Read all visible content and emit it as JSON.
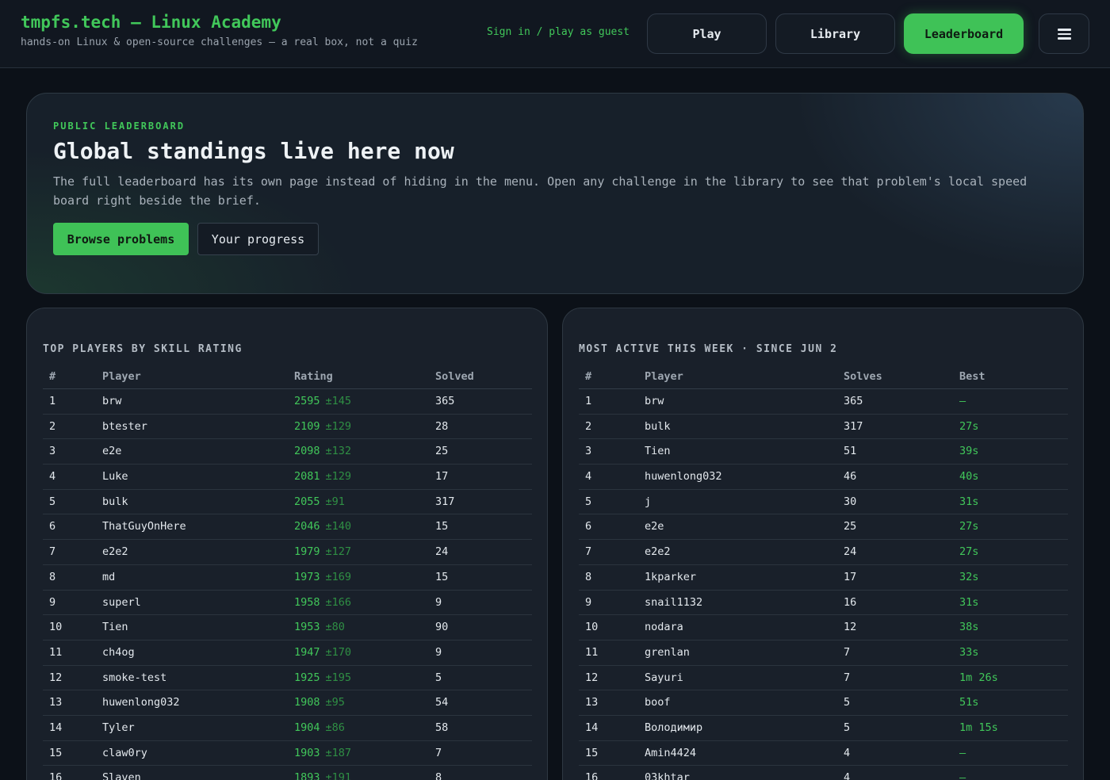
{
  "header": {
    "brand_title": "tmpfs.tech — Linux Academy",
    "brand_subtitle": "hands-on Linux & open-source challenges — a real box, not a quiz",
    "signin_label": "Sign in / play as guest",
    "nav": {
      "play": "Play",
      "library": "Library",
      "leaderboard": "Leaderboard"
    },
    "menu_icon": "hamburger-menu-icon",
    "accent_color": "#3fc257"
  },
  "hero": {
    "eyebrow": "PUBLIC LEADERBOARD",
    "title": "Global standings live here now",
    "description": "The full leaderboard has its own page instead of hiding in the menu. Open any challenge in the library to see that problem's local speed board right beside the brief.",
    "primary_button": "Browse problems",
    "secondary_button": "Your progress"
  },
  "top_players": {
    "title": "TOP PLAYERS BY SKILL RATING",
    "columns": [
      "#",
      "Player",
      "Rating",
      "Solved"
    ],
    "rows": [
      {
        "rank": "1",
        "player": "brw",
        "rating": "2595",
        "deviation": "±145",
        "solved": "365"
      },
      {
        "rank": "2",
        "player": "btester",
        "rating": "2109",
        "deviation": "±129",
        "solved": "28"
      },
      {
        "rank": "3",
        "player": "e2e",
        "rating": "2098",
        "deviation": "±132",
        "solved": "25"
      },
      {
        "rank": "4",
        "player": "Luke",
        "rating": "2081",
        "deviation": "±129",
        "solved": "17"
      },
      {
        "rank": "5",
        "player": "bulk",
        "rating": "2055",
        "deviation": "±91",
        "solved": "317"
      },
      {
        "rank": "6",
        "player": "ThatGuyOnHere",
        "rating": "2046",
        "deviation": "±140",
        "solved": "15"
      },
      {
        "rank": "7",
        "player": "e2e2",
        "rating": "1979",
        "deviation": "±127",
        "solved": "24"
      },
      {
        "rank": "8",
        "player": "md",
        "rating": "1973",
        "deviation": "±169",
        "solved": "15"
      },
      {
        "rank": "9",
        "player": "superl",
        "rating": "1958",
        "deviation": "±166",
        "solved": "9"
      },
      {
        "rank": "10",
        "player": "Tien",
        "rating": "1953",
        "deviation": "±80",
        "solved": "90"
      },
      {
        "rank": "11",
        "player": "ch4og",
        "rating": "1947",
        "deviation": "±170",
        "solved": "9"
      },
      {
        "rank": "12",
        "player": "smoke-test",
        "rating": "1925",
        "deviation": "±195",
        "solved": "5"
      },
      {
        "rank": "13",
        "player": "huwenlong032",
        "rating": "1908",
        "deviation": "±95",
        "solved": "54"
      },
      {
        "rank": "14",
        "player": "Tyler",
        "rating": "1904",
        "deviation": "±86",
        "solved": "58"
      },
      {
        "rank": "15",
        "player": "claw0ry",
        "rating": "1903",
        "deviation": "±187",
        "solved": "7"
      },
      {
        "rank": "16",
        "player": "Slaven",
        "rating": "1893",
        "deviation": "±191",
        "solved": "8"
      }
    ]
  },
  "most_active": {
    "title": "MOST ACTIVE THIS WEEK · SINCE JUN 2",
    "columns": [
      "#",
      "Player",
      "Solves",
      "Best"
    ],
    "rows": [
      {
        "rank": "1",
        "player": "brw",
        "solves": "365",
        "best": "—"
      },
      {
        "rank": "2",
        "player": "bulk",
        "solves": "317",
        "best": "27s"
      },
      {
        "rank": "3",
        "player": "Tien",
        "solves": "51",
        "best": "39s"
      },
      {
        "rank": "4",
        "player": "huwenlong032",
        "solves": "46",
        "best": "40s"
      },
      {
        "rank": "5",
        "player": "j",
        "solves": "30",
        "best": "31s"
      },
      {
        "rank": "6",
        "player": "e2e",
        "solves": "25",
        "best": "27s"
      },
      {
        "rank": "7",
        "player": "e2e2",
        "solves": "24",
        "best": "27s"
      },
      {
        "rank": "8",
        "player": "1kparker",
        "solves": "17",
        "best": "32s"
      },
      {
        "rank": "9",
        "player": "snail1132",
        "solves": "16",
        "best": "31s"
      },
      {
        "rank": "10",
        "player": "nodara",
        "solves": "12",
        "best": "38s"
      },
      {
        "rank": "11",
        "player": "grenlan",
        "solves": "7",
        "best": "33s"
      },
      {
        "rank": "12",
        "player": "Sayuri",
        "solves": "7",
        "best": "1m 26s"
      },
      {
        "rank": "13",
        "player": "boof",
        "solves": "5",
        "best": "51s"
      },
      {
        "rank": "14",
        "player": "Володимир",
        "solves": "5",
        "best": "1m 15s"
      },
      {
        "rank": "15",
        "player": "Amin4424",
        "solves": "4",
        "best": "—"
      },
      {
        "rank": "16",
        "player": "03khtar",
        "solves": "4",
        "best": "—"
      }
    ]
  }
}
